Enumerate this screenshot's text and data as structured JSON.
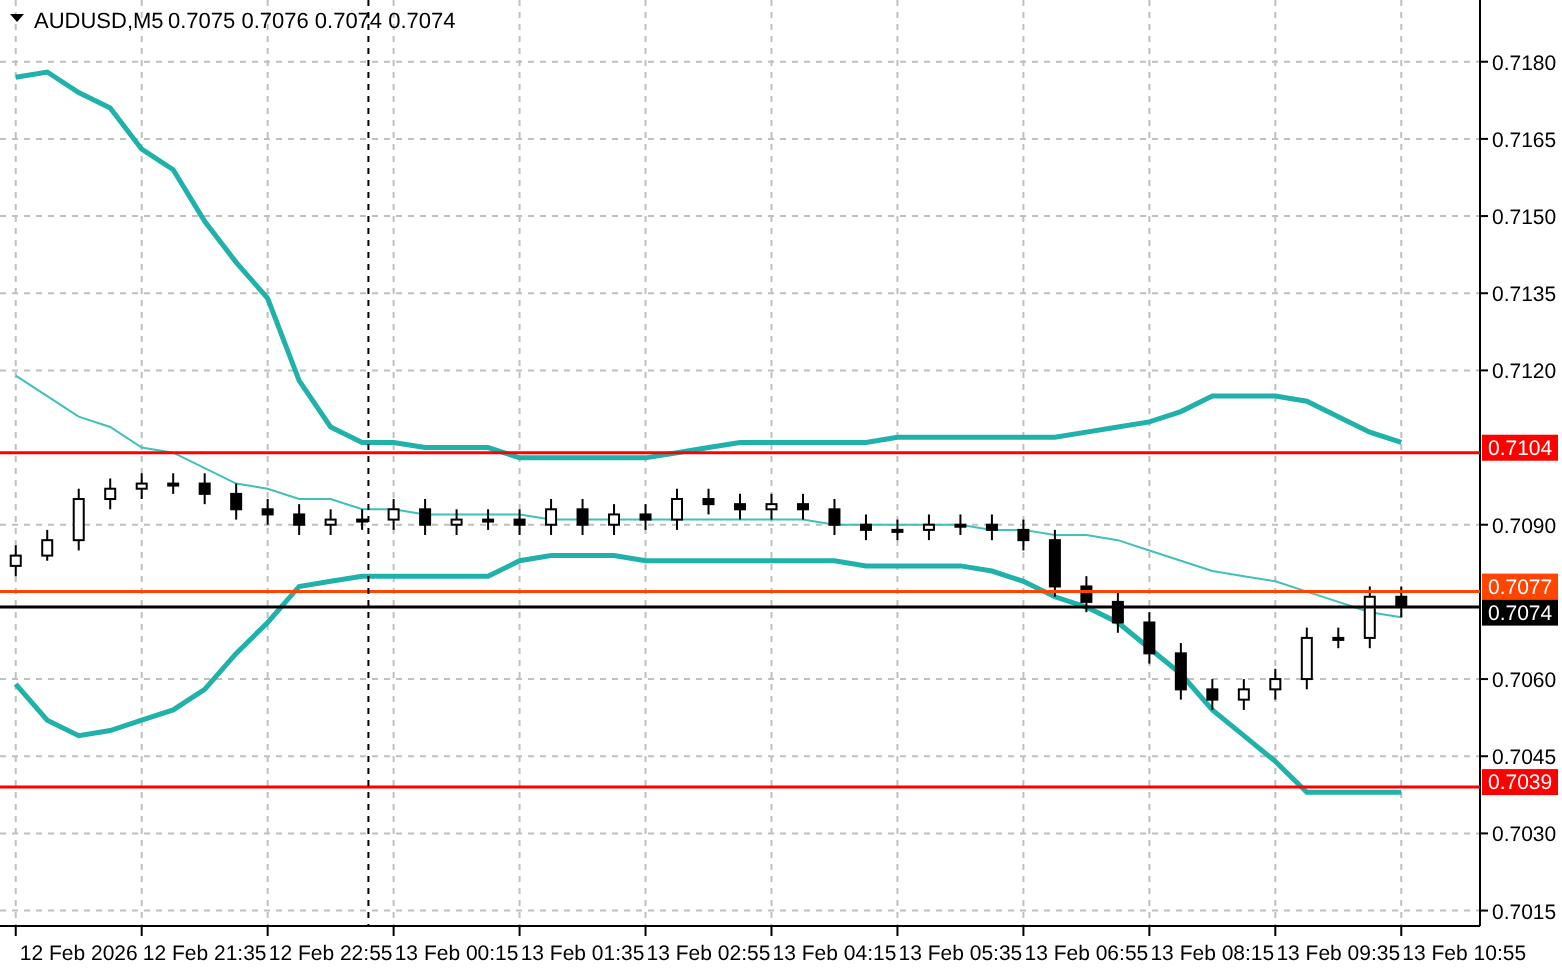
{
  "title": {
    "symbol": "AUDUSD,M5",
    "quote": "0.7075 0.7076 0.7074 0.7074"
  },
  "chart_data": {
    "type": "candlestick",
    "ylim": [
      0.7012,
      0.7192
    ],
    "categories": [
      null,
      null,
      "12 Feb 2026",
      null,
      null,
      null,
      "12 Feb 21:35",
      null,
      null,
      null,
      "12 Feb 22:55",
      null,
      null,
      null,
      "13 Feb 00:15",
      null,
      null,
      null,
      "13 Feb 01:35",
      null,
      null,
      null,
      "13 Feb 02:55",
      null,
      null,
      null,
      "13 Feb 04:15",
      null,
      null,
      null,
      "13 Feb 05:35",
      null,
      null,
      null,
      "13 Feb 06:55",
      null,
      null,
      null,
      "13 Feb 08:15",
      null,
      null,
      null,
      "13 Feb 09:35",
      null,
      null,
      null,
      "13 Feb 10:55"
    ],
    "grid": true,
    "yticks": [
      {
        "value": 0.718,
        "label": "0.7180"
      },
      {
        "value": 0.7165,
        "label": "0.7165"
      },
      {
        "value": 0.715,
        "label": "0.7150"
      },
      {
        "value": 0.7135,
        "label": "0.7135"
      },
      {
        "value": 0.712,
        "label": "0.7120"
      },
      {
        "value": 0.709,
        "label": "0.7090"
      },
      {
        "value": 0.706,
        "label": "0.7060"
      },
      {
        "value": 0.7045,
        "label": "0.7045"
      },
      {
        "value": 0.703,
        "label": "0.7030"
      },
      {
        "value": 0.7015,
        "label": "0.7015"
      }
    ],
    "ohlc": [
      [
        0.7082,
        0.7086,
        0.708,
        0.7084
      ],
      [
        0.7084,
        0.7089,
        0.7083,
        0.7087
      ],
      [
        0.7087,
        0.7097,
        0.7085,
        0.7095
      ],
      [
        0.7095,
        0.7099,
        0.7093,
        0.7097
      ],
      [
        0.7097,
        0.71,
        0.7095,
        0.7098
      ],
      [
        0.7098,
        0.71,
        0.7096,
        0.7098
      ],
      [
        0.7098,
        0.71,
        0.7094,
        0.7096
      ],
      [
        0.7096,
        0.7098,
        0.7091,
        0.7093
      ],
      [
        0.7093,
        0.7095,
        0.709,
        0.7092
      ],
      [
        0.7092,
        0.7094,
        0.7088,
        0.709
      ],
      [
        0.709,
        0.7093,
        0.7088,
        0.7091
      ],
      [
        0.7091,
        0.7093,
        0.7089,
        0.7091
      ],
      [
        0.7091,
        0.7095,
        0.7089,
        0.7093
      ],
      [
        0.7093,
        0.7095,
        0.7088,
        0.709
      ],
      [
        0.709,
        0.7093,
        0.7088,
        0.7091
      ],
      [
        0.7091,
        0.7093,
        0.7089,
        0.7091
      ],
      [
        0.7091,
        0.7093,
        0.7088,
        0.709
      ],
      [
        0.709,
        0.7095,
        0.7088,
        0.7093
      ],
      [
        0.7093,
        0.7095,
        0.7088,
        0.709
      ],
      [
        0.709,
        0.7094,
        0.7088,
        0.7092
      ],
      [
        0.7092,
        0.7094,
        0.7089,
        0.7091
      ],
      [
        0.7091,
        0.7097,
        0.7089,
        0.7095
      ],
      [
        0.7095,
        0.7097,
        0.7092,
        0.7094
      ],
      [
        0.7094,
        0.7096,
        0.7091,
        0.7093
      ],
      [
        0.7093,
        0.7096,
        0.7091,
        0.7094
      ],
      [
        0.7094,
        0.7096,
        0.7091,
        0.7093
      ],
      [
        0.7093,
        0.7095,
        0.7088,
        0.709
      ],
      [
        0.709,
        0.7092,
        0.7087,
        0.7089
      ],
      [
        0.7089,
        0.7091,
        0.7087,
        0.7089
      ],
      [
        0.7089,
        0.7092,
        0.7087,
        0.709
      ],
      [
        0.709,
        0.7092,
        0.7088,
        0.709
      ],
      [
        0.709,
        0.7092,
        0.7087,
        0.7089
      ],
      [
        0.7089,
        0.7091,
        0.7085,
        0.7087
      ],
      [
        0.7087,
        0.7089,
        0.7076,
        0.7078
      ],
      [
        0.7078,
        0.708,
        0.7073,
        0.7075
      ],
      [
        0.7075,
        0.7077,
        0.7069,
        0.7071
      ],
      [
        0.7071,
        0.7073,
        0.7063,
        0.7065
      ],
      [
        0.7065,
        0.7067,
        0.7056,
        0.7058
      ],
      [
        0.7058,
        0.706,
        0.7054,
        0.7056
      ],
      [
        0.7056,
        0.706,
        0.7054,
        0.7058
      ],
      [
        0.7058,
        0.7062,
        0.7056,
        0.706
      ],
      [
        0.706,
        0.707,
        0.7058,
        0.7068
      ],
      [
        0.7068,
        0.707,
        0.7066,
        0.7068
      ],
      [
        0.7068,
        0.7078,
        0.7066,
        0.7076
      ],
      [
        0.7076,
        0.7078,
        0.7072,
        0.7074
      ],
      null,
      null
    ],
    "series": [
      {
        "type": "line",
        "color": "#20b2aa",
        "values": [
          0.7177,
          0.7178,
          0.7174,
          0.7171,
          0.7163,
          0.7159,
          0.7149,
          0.7141,
          0.7134,
          0.7118,
          0.7109,
          0.7106,
          0.7106,
          0.7105,
          0.7105,
          0.7105,
          0.7103,
          0.7103,
          0.7103,
          0.7103,
          0.7103,
          0.7104,
          0.7105,
          0.7106,
          0.7106,
          0.7106,
          0.7106,
          0.7106,
          0.7107,
          0.7107,
          0.7107,
          0.7107,
          0.7107,
          0.7107,
          0.7108,
          0.7109,
          0.711,
          0.7112,
          0.7115,
          0.7115,
          0.7115,
          0.7114,
          0.7111,
          0.7108,
          0.7106,
          null,
          null
        ]
      },
      {
        "type": "line",
        "color": "#40c0b8",
        "values": [
          0.7119,
          0.7115,
          0.7111,
          0.7109,
          0.7105,
          0.7104,
          0.7101,
          0.7098,
          0.7097,
          0.7095,
          0.7095,
          0.7093,
          0.7093,
          0.7092,
          0.7092,
          0.7092,
          0.7092,
          0.7091,
          0.7091,
          0.7091,
          0.7091,
          0.7091,
          0.7091,
          0.7091,
          0.7091,
          0.7091,
          0.709,
          0.709,
          0.709,
          0.709,
          0.709,
          0.7089,
          0.7089,
          0.7088,
          0.7088,
          0.7087,
          0.7085,
          0.7083,
          0.7081,
          0.708,
          0.7079,
          0.7077,
          0.7075,
          0.7073,
          0.7072,
          null,
          null
        ]
      },
      {
        "type": "line",
        "color": "#20b2aa",
        "values": [
          0.7059,
          0.7052,
          0.7049,
          0.705,
          0.7052,
          0.7054,
          0.7058,
          0.7065,
          0.7071,
          0.7078,
          0.7079,
          0.708,
          0.708,
          0.708,
          0.708,
          0.708,
          0.7083,
          0.7084,
          0.7084,
          0.7084,
          0.7083,
          0.7083,
          0.7083,
          0.7083,
          0.7083,
          0.7083,
          0.7083,
          0.7082,
          0.7082,
          0.7082,
          0.7082,
          0.7081,
          0.7079,
          0.7076,
          0.7074,
          0.7071,
          0.7066,
          0.7061,
          0.7054,
          0.7049,
          0.7044,
          0.7038,
          0.7038,
          0.7038,
          0.7038,
          null,
          null
        ]
      }
    ],
    "ref_lines": [
      {
        "axis": "y",
        "value": 0.7104,
        "label": "0.7104",
        "color": "#ff0000"
      },
      {
        "axis": "y",
        "value": 0.7039,
        "label": "0.7039",
        "color": "#ff0000"
      },
      {
        "axis": "y",
        "value": 0.7077,
        "label": "0.7077",
        "color": "#ff4500"
      },
      {
        "axis": "y",
        "value": 0.7074,
        "label": "0.7074",
        "color": "#000000"
      }
    ]
  }
}
